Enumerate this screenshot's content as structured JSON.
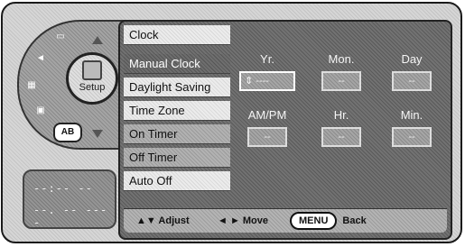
{
  "side": {
    "knob_label": "Setup",
    "badge": "AB",
    "clock_line1": "--:-- --",
    "clock_line2": "--. -- ----"
  },
  "menu": {
    "title": "Clock",
    "items": [
      "Manual Clock",
      "Daylight Saving",
      "Time Zone",
      "On Timer",
      "Off Timer",
      "Auto Off"
    ]
  },
  "fields": {
    "year": {
      "label": "Yr.",
      "value": "----"
    },
    "month": {
      "label": "Mon.",
      "value": "--"
    },
    "day": {
      "label": "Day",
      "value": "--"
    },
    "ampm": {
      "label": "AM/PM",
      "value": "--"
    },
    "hour": {
      "label": "Hr.",
      "value": "--"
    },
    "minute": {
      "label": "Min.",
      "value": "--"
    }
  },
  "footer": {
    "adjust": "▲▼ Adjust",
    "move": "◄ ► Move",
    "menu_key": "MENU",
    "back": "Back"
  }
}
